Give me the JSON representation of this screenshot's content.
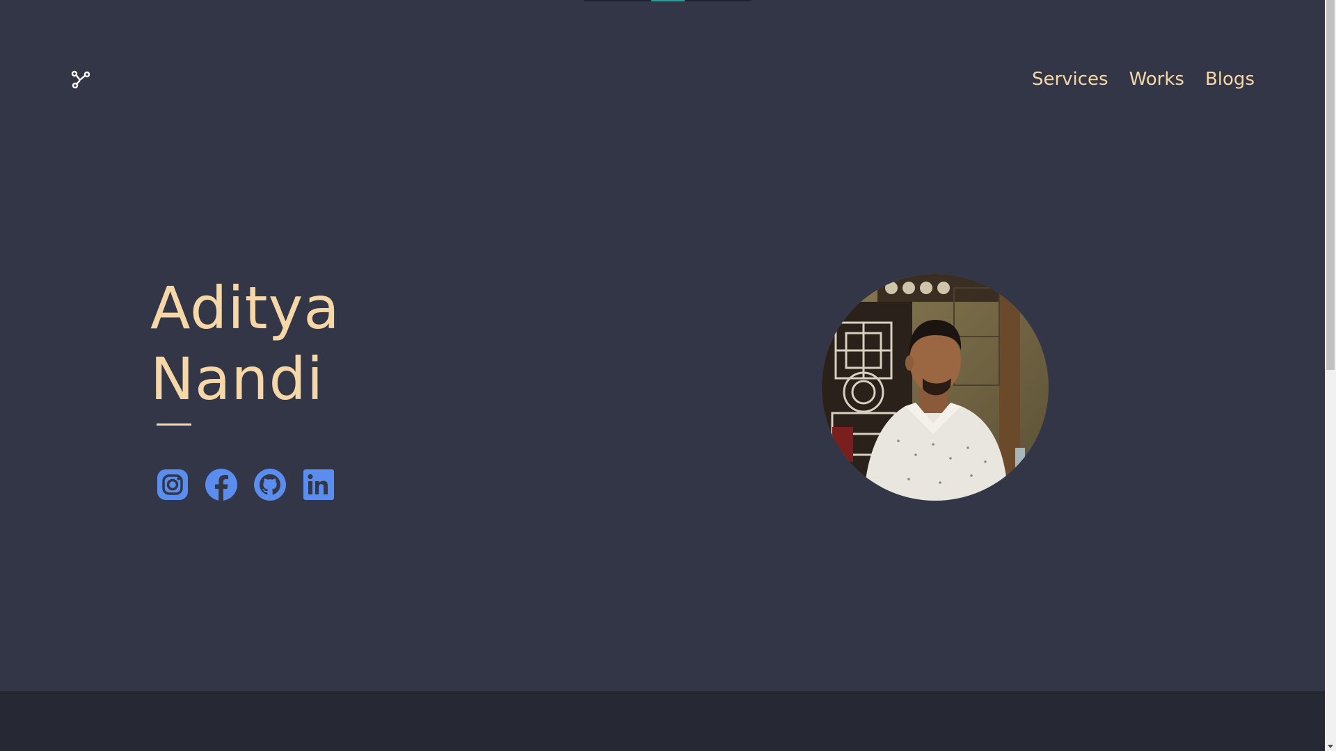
{
  "header": {
    "logo_icon": "network-nodes-icon",
    "nav": [
      {
        "label": "Services"
      },
      {
        "label": "Works"
      },
      {
        "label": "Blogs"
      }
    ]
  },
  "hero": {
    "first_name": "Aditya",
    "last_name": "Nandi",
    "socials": [
      {
        "icon": "instagram-icon"
      },
      {
        "icon": "facebook-icon"
      },
      {
        "icon": "github-icon"
      },
      {
        "icon": "linkedin-icon"
      }
    ],
    "avatar_icon": "profile-photo"
  },
  "colors": {
    "background": "#323646",
    "accent": "#f6d7a7",
    "social": "#5b8def",
    "footer": "#262834"
  }
}
